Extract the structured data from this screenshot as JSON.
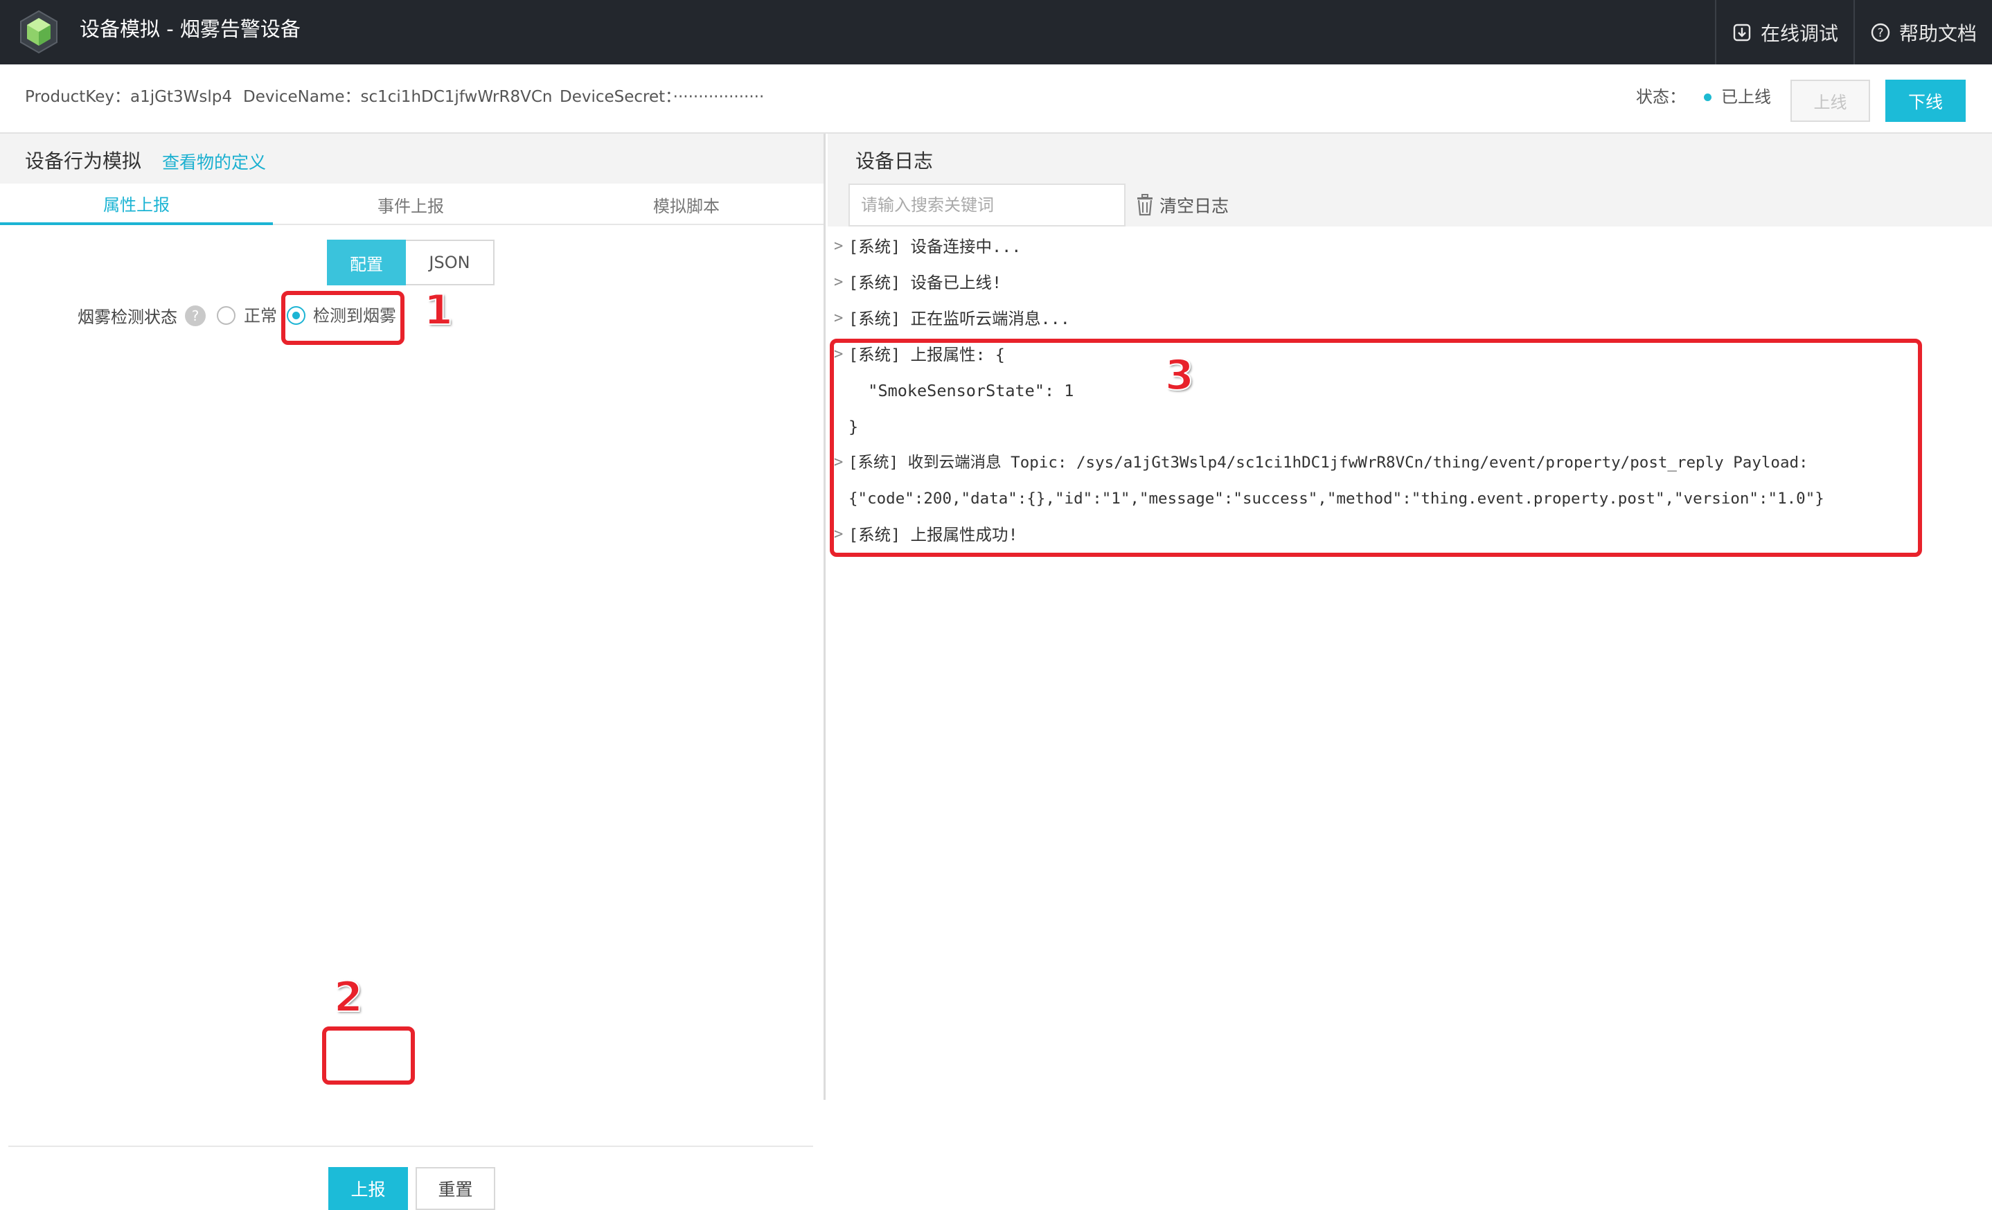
{
  "header": {
    "title": "设备模拟 - 烟雾告警设备",
    "actions": [
      "在线调试",
      "帮助文档"
    ]
  },
  "device": {
    "product_key": "ProductKey：a1jGt3Wslp4",
    "device_name": "DeviceName：sc1ci1hDC1jfwWrR8VCn",
    "device_secret": "DeviceSecret：··················",
    "status_label": "状态：",
    "status_value": "已上线",
    "online_button": "上线",
    "offline_button": "下线"
  },
  "left": {
    "title": "设备行为模拟",
    "link": "查看物的定义",
    "tabs": [
      "属性上报",
      "事件上报",
      "模拟脚本"
    ],
    "modes": [
      "配置",
      "JSON"
    ],
    "property": {
      "label": "烟雾检测状态",
      "help": "?",
      "options": [
        "正常",
        "检测到烟雾"
      ],
      "selected_index": 1
    },
    "report_button": "上报",
    "reset_button": "重置"
  },
  "right": {
    "title": "设备日志",
    "search_placeholder": "请输入搜索关键词",
    "clear_button": "清空日志",
    "logs": [
      "[系统] 设备连接中...",
      "[系统] 设备已上线!",
      "[系统] 正在监听云端消息...",
      "[系统] 上报属性: {",
      "  \"SmokeSensorState\": 1",
      "}",
      "[系统] 收到云端消息 Topic: /sys/a1jGt3Wslp4/sc1ci1hDC1jfwWrR8VCn/thing/event/property/post_reply Payload:",
      "{\"code\":200,\"data\":{},\"id\":\"1\",\"message\":\"success\",\"method\":\"thing.event.property.post\",\"version\":\"1.0\"}",
      "[系统] 上报属性成功!"
    ]
  },
  "annotations": [
    "1",
    "2",
    "3"
  ],
  "colors": {
    "accent": "#1cbbd8",
    "topbar": "#23272d",
    "annotation_red": "#e8222b"
  }
}
